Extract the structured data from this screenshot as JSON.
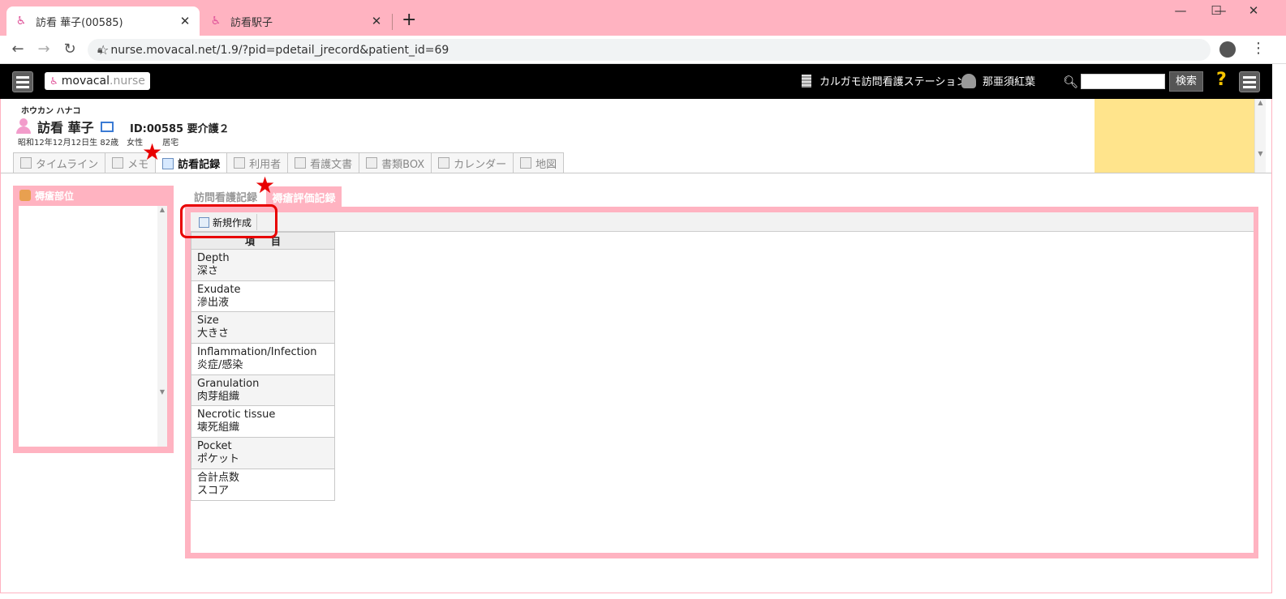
{
  "browser": {
    "tabs": [
      {
        "title": "訪看 華子(00585)",
        "active": true
      },
      {
        "title": "訪看駅子",
        "active": false
      }
    ],
    "new_tab": "+",
    "close": "✕",
    "url": "nurse.movacal.net/1.9/?pid=pdetail_jrecord&patient_id=69",
    "window_controls": {
      "minimize": "—",
      "maximize": "☐",
      "close": "✕"
    }
  },
  "app": {
    "logo_main": "movacal",
    "logo_suffix": ".nurse",
    "station": "カルガモ訪問看護ステーション",
    "user": "那亜須紅葉",
    "search_button": "検索",
    "help": "?"
  },
  "patient": {
    "kana": "ホウカン ハナコ",
    "name": "訪看 華子",
    "id_line": "ID:00585 要介護２",
    "birth": "昭和12年12月12日生 82歳",
    "sex": "女性",
    "residence": "居宅"
  },
  "module_tabs": [
    {
      "label": "タイムライン",
      "icon": "timeline-icon"
    },
    {
      "label": "メモ",
      "icon": "pencil-icon"
    },
    {
      "label": "訪看記録",
      "icon": "record-icon",
      "active": true
    },
    {
      "label": "利用者",
      "icon": "user-card-icon"
    },
    {
      "label": "看護文書",
      "icon": "pdf-icon"
    },
    {
      "label": "書類BOX",
      "icon": "box-icon"
    },
    {
      "label": "カレンダー",
      "icon": "calendar-icon"
    },
    {
      "label": "地図",
      "icon": "map-icon"
    }
  ],
  "left_panel": {
    "title": "褥瘡部位"
  },
  "sub_tabs": [
    {
      "label": "訪問看護記録",
      "active": false
    },
    {
      "label": "褥瘡評価記録",
      "active": true
    }
  ],
  "toolbar": {
    "new_label": "新規作成"
  },
  "table": {
    "header": "項目",
    "rows": [
      {
        "en": "Depth",
        "ja": "深さ"
      },
      {
        "en": "Exudate",
        "ja": "滲出液"
      },
      {
        "en": "Size",
        "ja": "大きさ"
      },
      {
        "en": "Inflammation/Infection",
        "ja": "炎症/感染"
      },
      {
        "en": "Granulation",
        "ja": "肉芽組織"
      },
      {
        "en": "Necrotic tissue",
        "ja": "壊死組織"
      },
      {
        "en": "Pocket",
        "ja": "ポケット"
      },
      {
        "en": "合計点数",
        "ja": "スコア"
      }
    ]
  },
  "annotations": {
    "star": "★",
    "accent": "#e80000"
  },
  "colors": {
    "brand_pink": "#ffb3c1",
    "header_black": "#000000",
    "note_yellow": "#ffe48c"
  }
}
